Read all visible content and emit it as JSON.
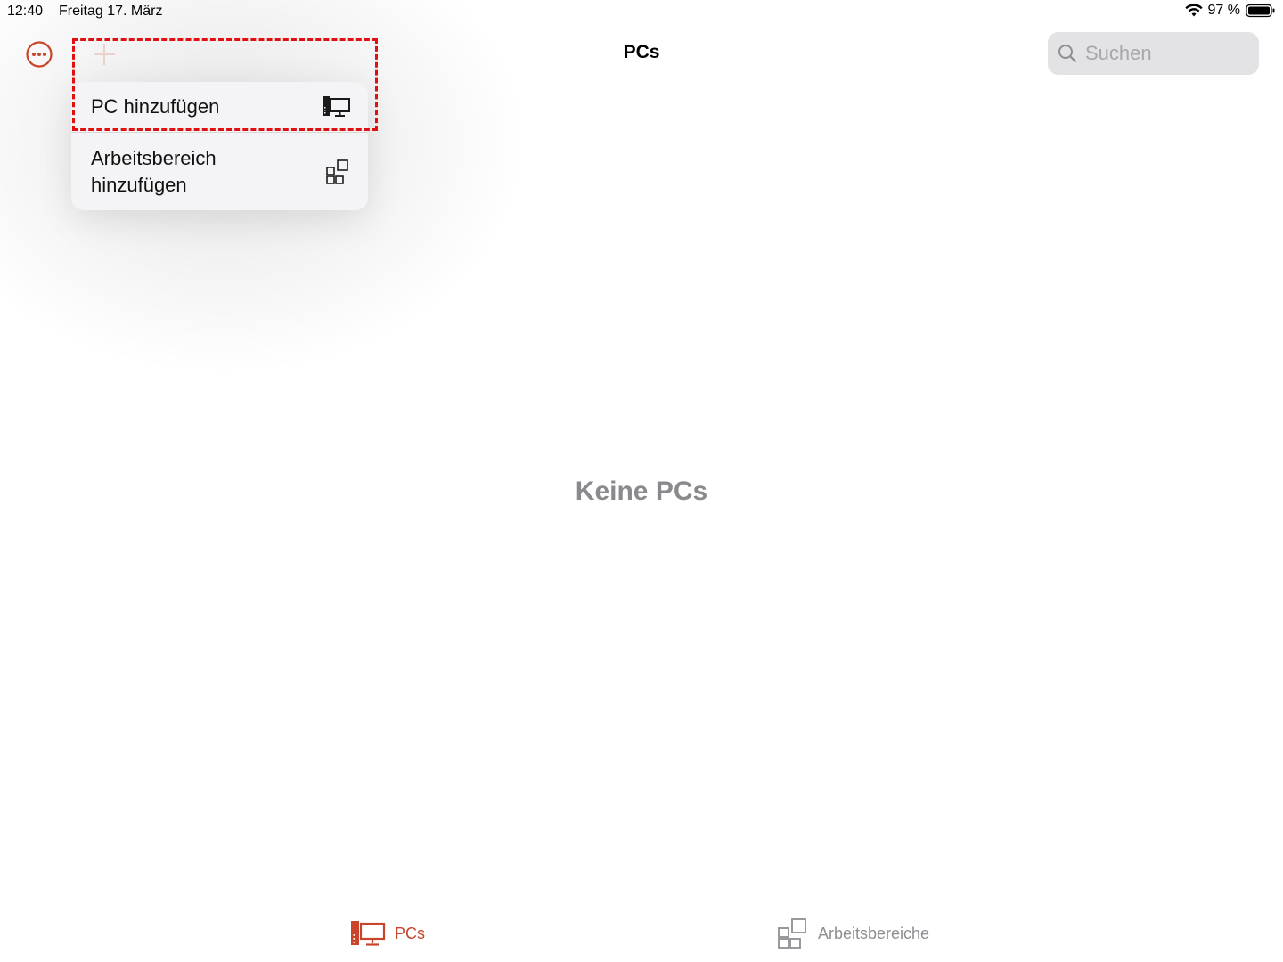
{
  "status_bar": {
    "time": "12:40",
    "date": "Freitag 17. März",
    "battery": "97 %",
    "icons": [
      "wifi-icon",
      "battery-icon"
    ]
  },
  "nav": {
    "title": "PCs",
    "more_icon": "ellipsis-circle-icon",
    "add_icon": "plus-icon",
    "search_placeholder": "Suchen"
  },
  "menu": {
    "items": [
      {
        "label": "PC hinzufügen",
        "icon": "desktop-pc-icon"
      },
      {
        "label": "Arbeitsbereich hinzufügen",
        "icon": "workspace-grid-icon"
      }
    ]
  },
  "empty_state": {
    "text": "Keine PCs"
  },
  "tab_bar": {
    "tabs": [
      {
        "label": "PCs",
        "icon": "desktop-pc-icon",
        "selected": true
      },
      {
        "label": "Arbeitsbereiche",
        "icon": "workspace-grid-icon",
        "selected": false
      }
    ]
  },
  "colors": {
    "accent": "#c8442a",
    "highlight": "#e01010",
    "muted": "#8e8e93"
  }
}
